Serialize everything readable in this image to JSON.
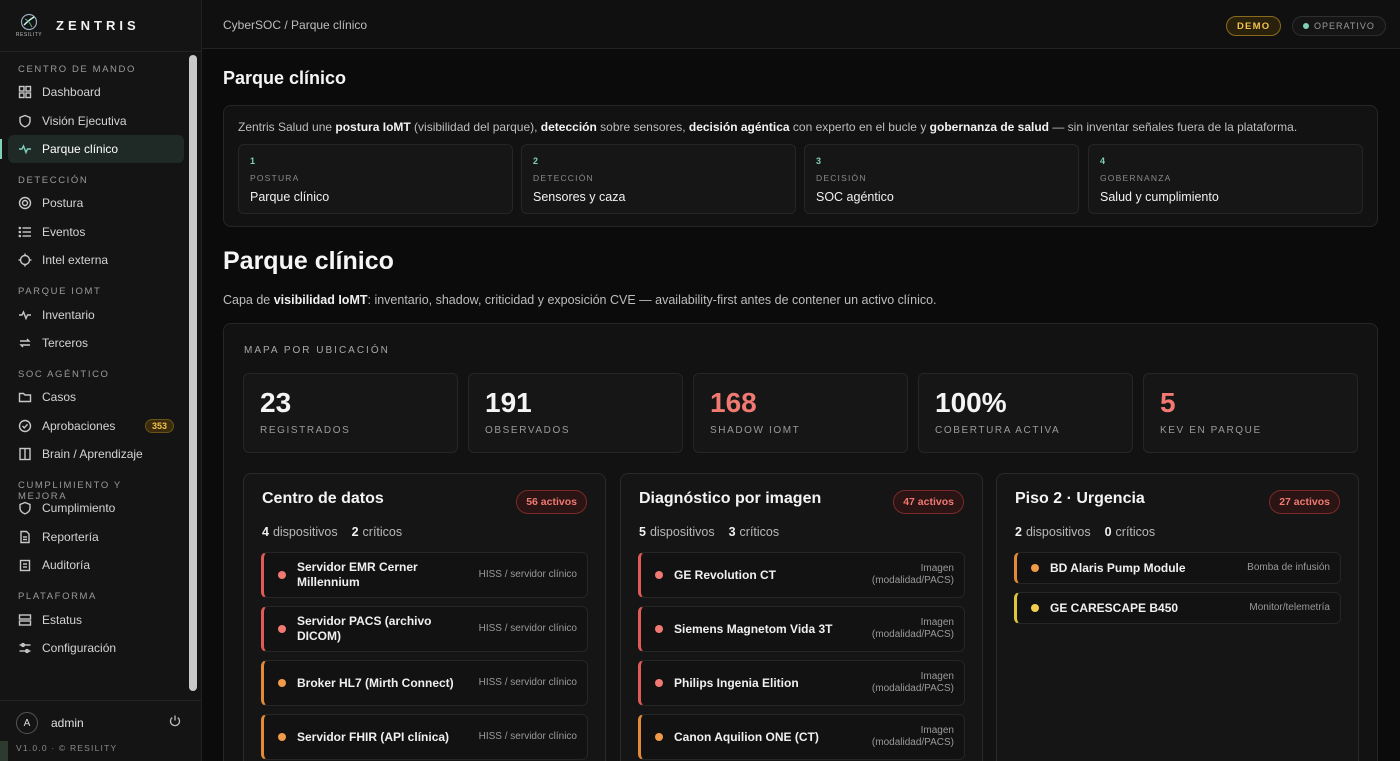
{
  "brand": {
    "name": "ZENTRIS",
    "logo_text": "RESILITY"
  },
  "sidebar": {
    "groups": [
      {
        "title": "CENTRO DE MANDO",
        "items": [
          {
            "label": "Dashboard",
            "icon": "grid-icon"
          },
          {
            "label": "Visión Ejecutiva",
            "icon": "shield-icon"
          },
          {
            "label": "Parque clínico",
            "icon": "pulse-icon",
            "active": true
          }
        ]
      },
      {
        "title": "DETECCIÓN",
        "items": [
          {
            "label": "Postura",
            "icon": "target-icon"
          },
          {
            "label": "Eventos",
            "icon": "list-icon"
          },
          {
            "label": "Intel externa",
            "icon": "crosshair-icon"
          }
        ]
      },
      {
        "title": "PARQUE IOMT",
        "items": [
          {
            "label": "Inventario",
            "icon": "pulse-icon"
          },
          {
            "label": "Terceros",
            "icon": "arrows-icon"
          }
        ]
      },
      {
        "title": "SOC AGÉNTICO",
        "items": [
          {
            "label": "Casos",
            "icon": "folder-icon"
          },
          {
            "label": "Aprobaciones",
            "icon": "check-circle-icon",
            "badge": "353"
          },
          {
            "label": "Brain / Aprendizaje",
            "icon": "book-icon"
          }
        ]
      },
      {
        "title": "CUMPLIMIENTO Y MEJORA",
        "items": [
          {
            "label": "Cumplimiento",
            "icon": "shield-icon"
          },
          {
            "label": "Reportería",
            "icon": "file-icon"
          },
          {
            "label": "Auditoría",
            "icon": "clipboard-icon"
          }
        ]
      },
      {
        "title": "PLATAFORMA",
        "items": [
          {
            "label": "Estatus",
            "icon": "server-icon"
          },
          {
            "label": "Configuración",
            "icon": "sliders-icon"
          }
        ]
      }
    ],
    "user": {
      "initial": "A",
      "name": "admin"
    },
    "version": "V1.0.0 · © RESILITY"
  },
  "topbar": {
    "breadcrumb": "CyberSOC / Parque clínico",
    "demo": "DEMO",
    "status": "OPERATIVO"
  },
  "header": {
    "title": "Parque clínico"
  },
  "intro": {
    "parts": [
      {
        "t": "Zentris Salud une ",
        "b": false
      },
      {
        "t": "postura IoMT",
        "b": true
      },
      {
        "t": " (visibilidad del parque), ",
        "b": false
      },
      {
        "t": "detección",
        "b": true
      },
      {
        "t": " sobre sensores, ",
        "b": false
      },
      {
        "t": "decisión agéntica",
        "b": true
      },
      {
        "t": " con experto en el bucle y ",
        "b": false
      },
      {
        "t": "gobernanza de salud",
        "b": true
      },
      {
        "t": " — sin inventar señales fuera de la plataforma.",
        "b": false
      }
    ],
    "steps": [
      {
        "num": "1",
        "sub": "POSTURA",
        "title": "Parque clínico"
      },
      {
        "num": "2",
        "sub": "DETECCIÓN",
        "title": "Sensores y caza"
      },
      {
        "num": "3",
        "sub": "DECISIÓN",
        "title": "SOC agéntico"
      },
      {
        "num": "4",
        "sub": "GOBERNANZA",
        "title": "Salud y cumplimiento"
      }
    ]
  },
  "section": {
    "title": "Parque clínico",
    "desc_parts": [
      {
        "t": "Capa de ",
        "b": false
      },
      {
        "t": "visibilidad IoMT",
        "b": true
      },
      {
        "t": ": inventario, shadow, criticidad y exposición CVE — availability-first antes de contener un activo clínico.",
        "b": false
      }
    ]
  },
  "map": {
    "title": "MAPA POR UBICACIÓN",
    "stats": [
      {
        "value": "23",
        "label": "REGISTRADOS",
        "highlight": false
      },
      {
        "value": "191",
        "label": "OBSERVADOS",
        "highlight": false
      },
      {
        "value": "168",
        "label": "SHADOW IOMT",
        "highlight": true
      },
      {
        "value": "100%",
        "label": "COBERTURA ACTIVA",
        "highlight": false
      },
      {
        "value": "5",
        "label": "KEV EN PARQUE",
        "highlight": true
      }
    ],
    "locations": [
      {
        "title": "Centro de datos",
        "badge": "56 activos",
        "devices_count": "4",
        "devices_label": "dispositivos",
        "critical_count": "2",
        "critical_label": "críticos",
        "devices": [
          {
            "name": "Servidor EMR Cerner Millennium",
            "type": "HISS / servidor clínico",
            "severity": "red"
          },
          {
            "name": "Servidor PACS (archivo DICOM)",
            "type": "HISS / servidor clínico",
            "severity": "red"
          },
          {
            "name": "Broker HL7 (Mirth Connect)",
            "type": "HISS / servidor clínico",
            "severity": "orange"
          },
          {
            "name": "Servidor FHIR (API clínica)",
            "type": "HISS / servidor clínico",
            "severity": "orange"
          }
        ]
      },
      {
        "title": "Diagnóstico por imagen",
        "badge": "47 activos",
        "devices_count": "5",
        "devices_label": "dispositivos",
        "critical_count": "3",
        "critical_label": "críticos",
        "devices": [
          {
            "name": "GE Revolution CT",
            "type": "Imagen (modalidad/PACS)",
            "severity": "red"
          },
          {
            "name": "Siemens Magnetom Vida 3T",
            "type": "Imagen (modalidad/PACS)",
            "severity": "red"
          },
          {
            "name": "Philips Ingenia Elition",
            "type": "Imagen (modalidad/PACS)",
            "severity": "red"
          },
          {
            "name": "Canon Aquilion ONE (CT)",
            "type": "Imagen (modalidad/PACS)",
            "severity": "orange"
          }
        ]
      },
      {
        "title": "Piso 2 · Urgencia",
        "badge": "27 activos",
        "devices_count": "2",
        "devices_label": "dispositivos",
        "critical_count": "0",
        "critical_label": "críticos",
        "devices": [
          {
            "name": "BD Alaris Pump Module",
            "type": "Bomba de infusión",
            "severity": "orange"
          },
          {
            "name": "GE CARESCAPE B450",
            "type": "Monitor/telemetría",
            "severity": "yellow"
          }
        ]
      }
    ]
  },
  "colors": {
    "accent": "#7fd1b9",
    "critical": "#f07a72",
    "warning": "#f09a4a",
    "caution": "#f2cf4a",
    "demo": "#f2c14e"
  }
}
